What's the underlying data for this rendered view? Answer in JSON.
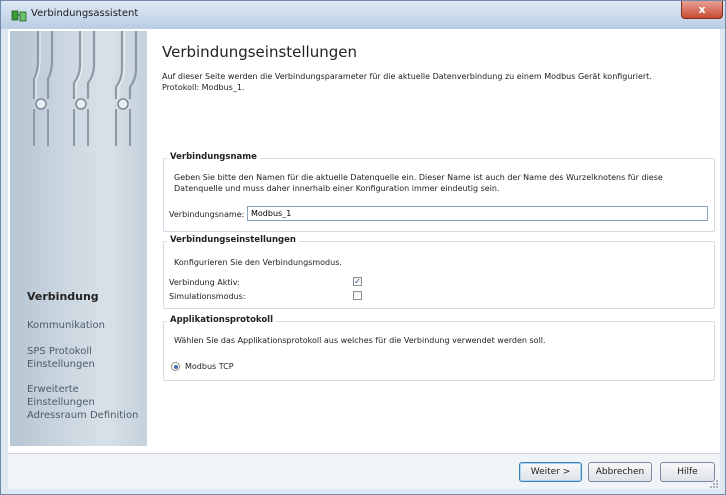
{
  "window": {
    "title": "Verbindungsassistent",
    "close_label": "x",
    "icon": "app-icon"
  },
  "sidebar": {
    "items": [
      {
        "label": "Verbindung",
        "active": true
      },
      {
        "label": "Kommunikation",
        "active": false
      },
      {
        "label": "SPS Protokoll Einstellungen",
        "active": false
      },
      {
        "label": "Erweiterte Einstellungen",
        "active": false
      },
      {
        "label": "Adressraum Definition",
        "active": false
      }
    ]
  },
  "page": {
    "title": "Verbindungseinstellungen",
    "description_line1": "Auf dieser Seite werden die Verbindungsparameter für die aktuelle Datenverbindung zu einem Modbus Gerät konfiguriert.",
    "description_line2": "Protokoll: Modbus_1."
  },
  "groups": {
    "name": {
      "title": "Verbindungsname",
      "text_line1": "Geben Sie bitte den Namen für die aktuelle Datenquelle ein. Dieser Name ist auch der Name des Wurzelknotens für diese",
      "text_line2": "Datenquelle und muss daher innerhalb einer Konfiguration immer eindeutig sein.",
      "field_label": "Verbindungsname:",
      "field_value": "Modbus_1"
    },
    "settings": {
      "title": "Verbindungseinstellungen",
      "text": "Konfigurieren Sie den Verbindungsmodus.",
      "active_label": "Verbindung Aktiv:",
      "active_checked": true,
      "sim_label": "Simulationsmodus:",
      "sim_checked": false
    },
    "protocol": {
      "title": "Applikationsprotokoll",
      "text": "Wählen Sie das Applikationsprotokoll aus welches für die Verbindung verwendet werden soll.",
      "option_label": "Modbus TCP",
      "option_selected": true
    }
  },
  "buttons": {
    "next": "Weiter >",
    "cancel": "Abbrechen",
    "help": "Hilfe"
  },
  "colors": {
    "accent": "#3c7fb1",
    "titlebar": "#b9cde3",
    "close": "#c74a32"
  }
}
